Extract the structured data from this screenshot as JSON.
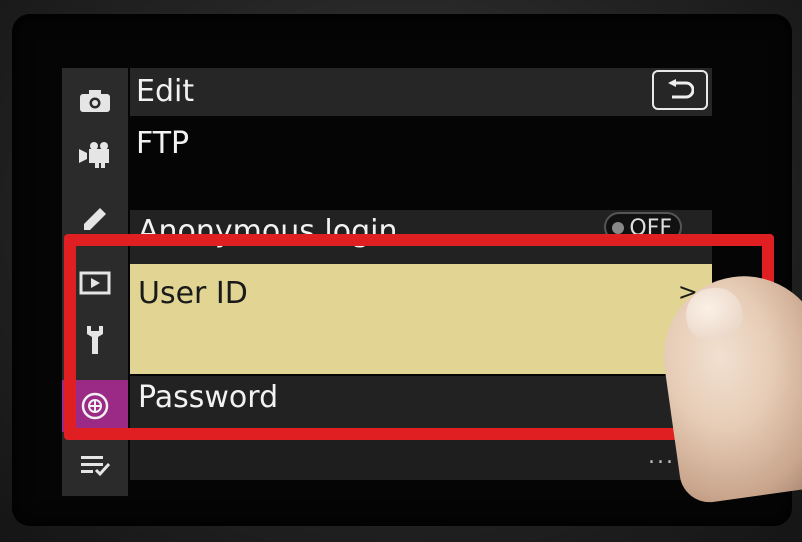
{
  "header": {
    "title": "Edit",
    "back_icon": "return-arrow-icon"
  },
  "subtitle": "FTP",
  "sidebar": {
    "items": [
      {
        "icon": "camera-icon"
      },
      {
        "icon": "movie-camera-icon"
      },
      {
        "icon": "pencil-icon"
      },
      {
        "icon": "playback-icon"
      },
      {
        "icon": "wrench-icon"
      },
      {
        "icon": "network-icon",
        "active": true
      },
      {
        "icon": "my-menu-icon"
      }
    ]
  },
  "rows": {
    "anonymous_login": {
      "label": "Anonymous login",
      "value": "OFF"
    },
    "user_id": {
      "label": "User ID",
      "chevron": ">"
    },
    "password": {
      "label": "Password",
      "chevron": ">"
    }
  },
  "more_indicator": "...",
  "colors": {
    "highlight_border": "#e01f23",
    "selected_row": "#e2d594",
    "active_tab": "#9b2a86"
  }
}
